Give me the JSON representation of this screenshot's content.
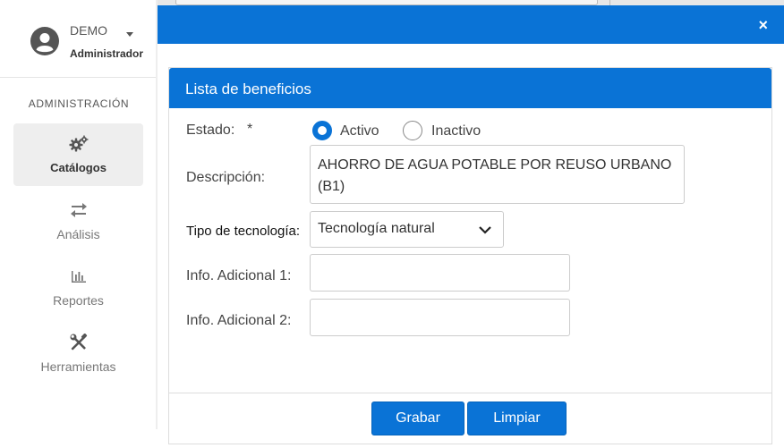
{
  "user": {
    "name": "DEMO",
    "role": "Administrador"
  },
  "sidebar": {
    "section_title": "ADMINISTRACIÓN",
    "items": [
      {
        "label": "Catálogos",
        "icon": "gears-icon",
        "active": true
      },
      {
        "label": "Análisis",
        "icon": "exchange-icon",
        "active": false
      },
      {
        "label": "Reportes",
        "icon": "bar-chart-icon",
        "active": false
      },
      {
        "label": "Herramientas",
        "icon": "tools-icon",
        "active": false
      }
    ]
  },
  "modal": {
    "close": "×"
  },
  "form": {
    "title": "Lista de beneficios",
    "estado_label": "Estado:",
    "required_mark": "*",
    "estado_options": [
      {
        "label": "Activo",
        "selected": true
      },
      {
        "label": "Inactivo",
        "selected": false
      }
    ],
    "descripcion_label": "Descripción:",
    "descripcion_value": "AHORRO DE AGUA POTABLE POR REUSO URBANO (B1)",
    "tipo_label": "Tipo de tecnología:",
    "tipo_value": "Tecnología natural",
    "info1_label": "Info. Adicional 1:",
    "info1_value": "",
    "info2_label": "Info. Adicional 2:",
    "info2_value": ""
  },
  "buttons": {
    "save": "Grabar",
    "clear": "Limpiar"
  },
  "colors": {
    "primary": "#0a73d6",
    "sidebar_active": "#eeeeee"
  }
}
